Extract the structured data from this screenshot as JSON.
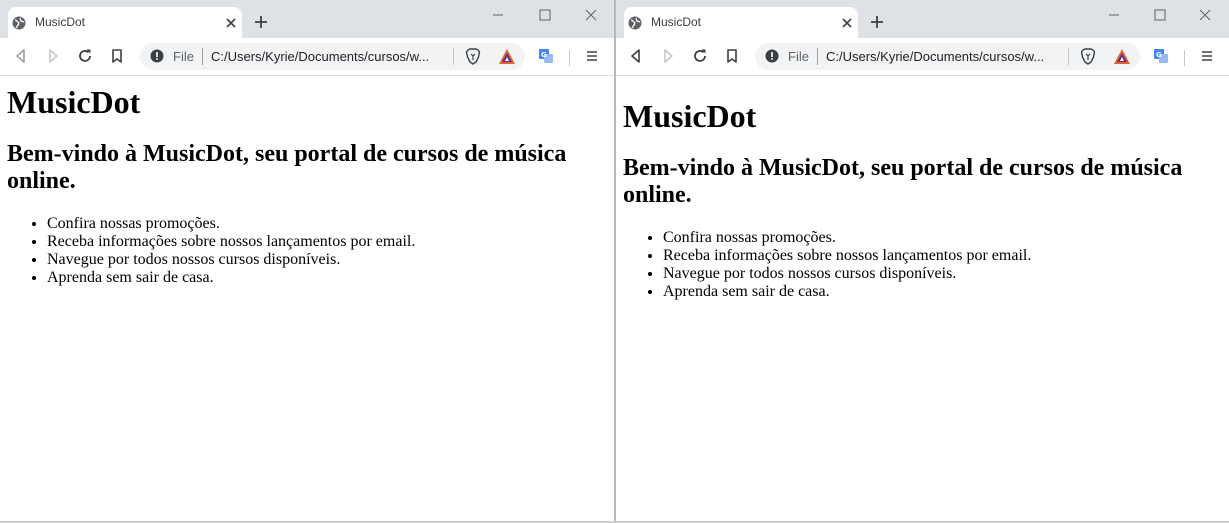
{
  "browser": {
    "tab_title": "MusicDot",
    "address_scheme": "File",
    "address_url": "C:/Users/Kyrie/Documents/cursos/w..."
  },
  "page": {
    "heading": "MusicDot",
    "subheading": "Bem-vindo à MusicDot, seu portal de cursos de música online.",
    "items": [
      "Confira nossas promoções.",
      "Receba informações sobre nossos lançamentos por email.",
      "Navegue por todos nossos cursos disponíveis.",
      "Aprenda sem sair de casa."
    ]
  },
  "colors": {
    "tabstrip_bg": "#dee1e6",
    "omnibox_bg": "#f1f3f4",
    "brave_orange": "#e2622a",
    "bat_purple": "#662d91",
    "translate_blue": "#4285f4"
  },
  "icons": [
    "globe-icon",
    "close-icon",
    "plus-icon",
    "minimize-icon",
    "maximize-icon",
    "back-icon",
    "forward-icon",
    "reload-icon",
    "bookmark-icon",
    "info-icon",
    "brave-shield-icon",
    "bat-icon",
    "translate-icon",
    "menu-icon"
  ]
}
